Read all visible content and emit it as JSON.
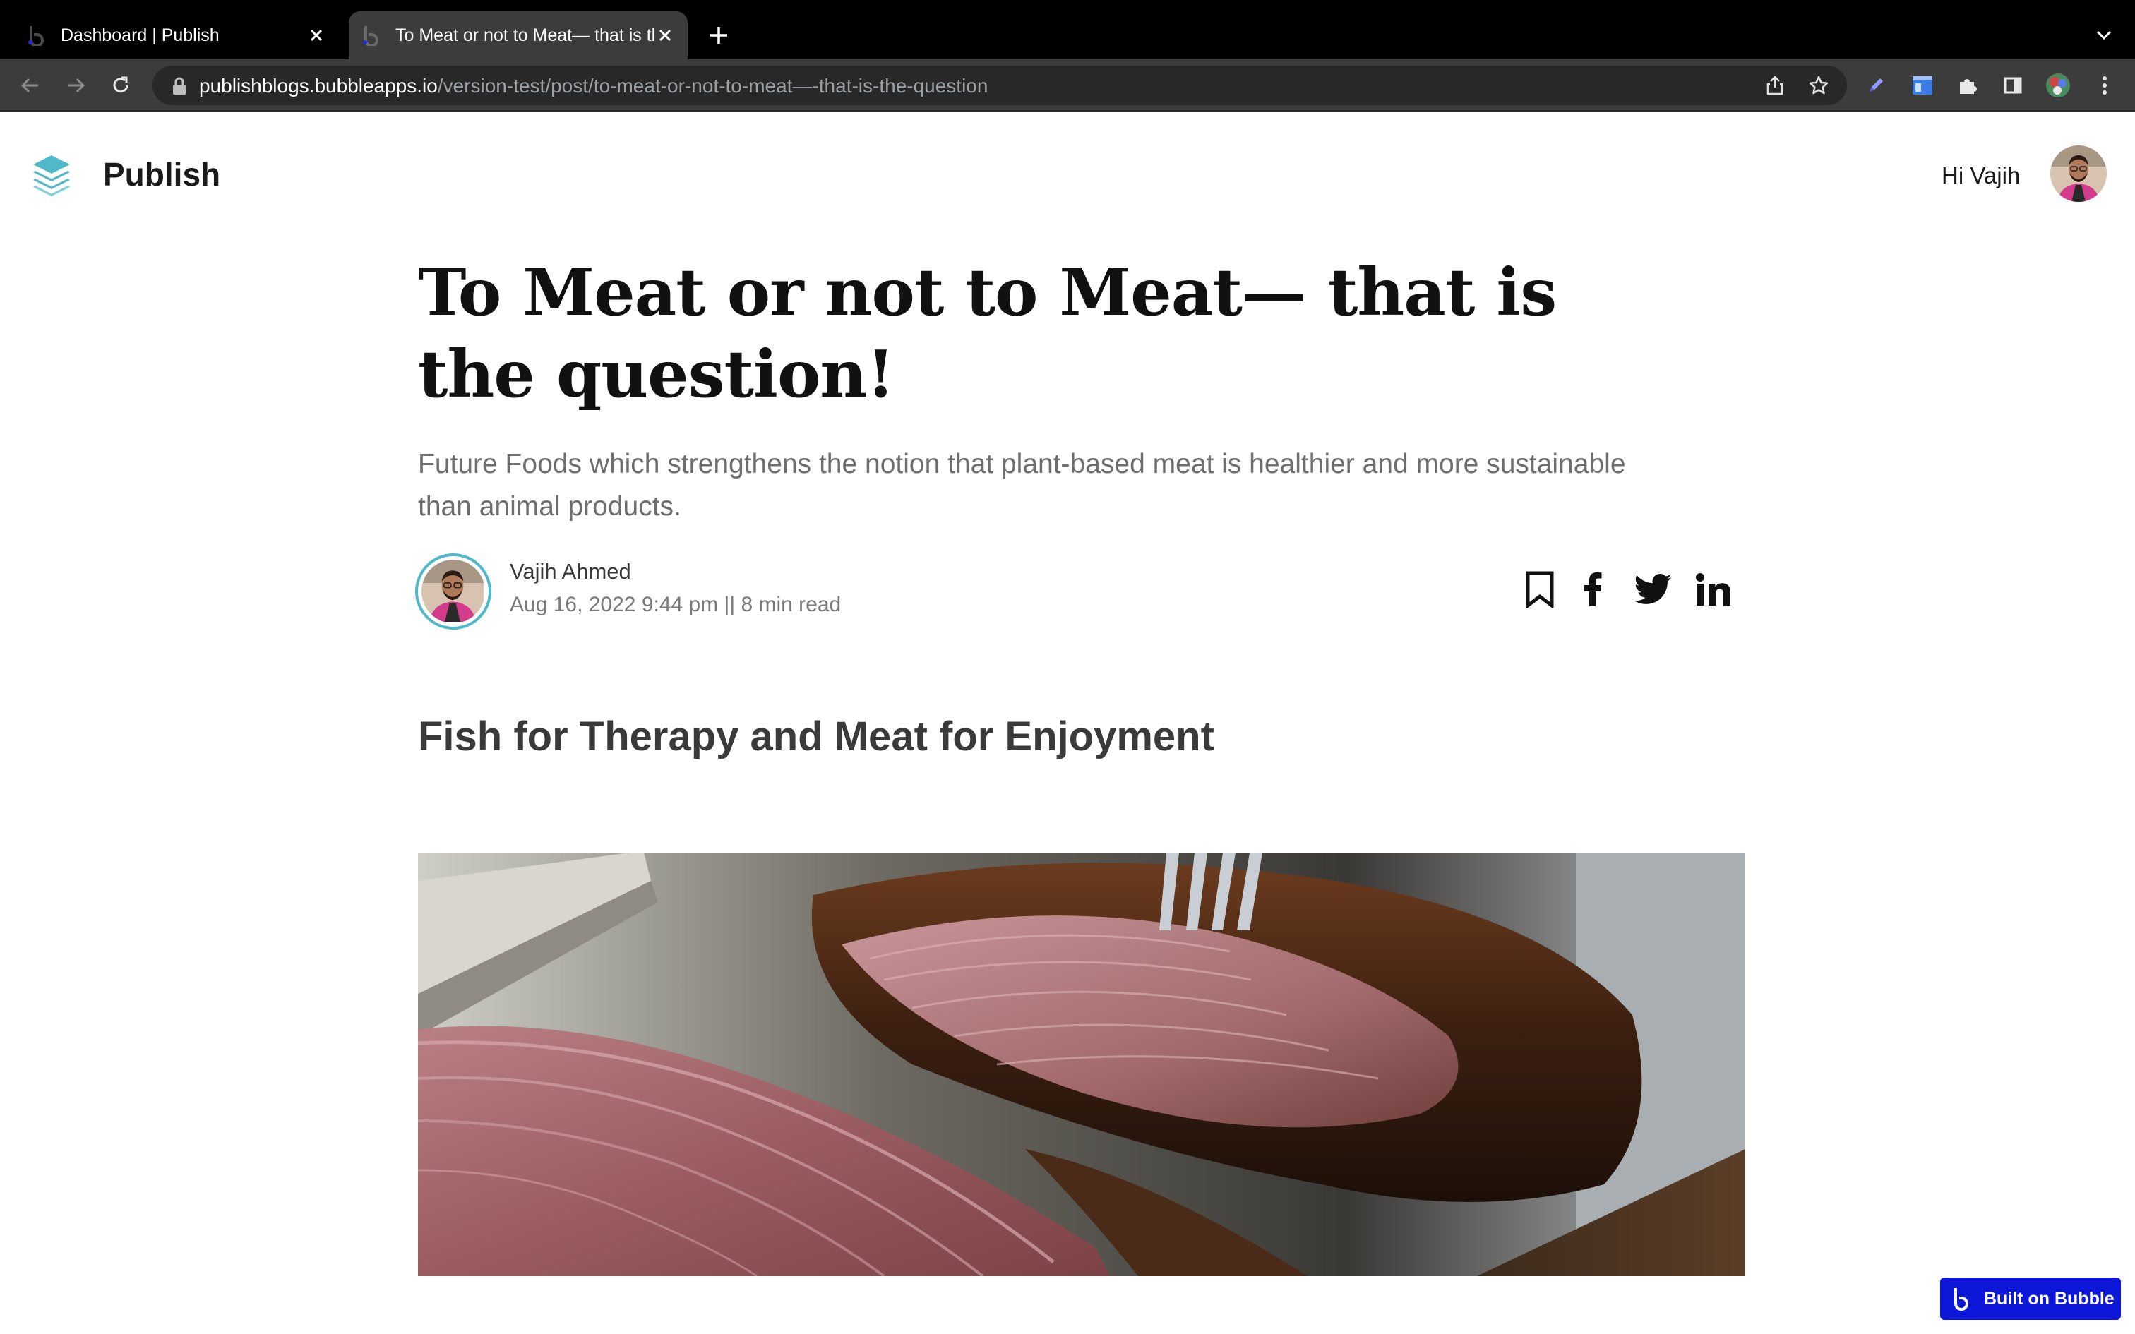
{
  "browser": {
    "tabs": [
      {
        "title": "Dashboard | Publish",
        "active": false
      },
      {
        "title": "To Meat or not to Meat— that is the question!",
        "active": true
      }
    ],
    "url_host": "publishblogs.bubbleapps.io",
    "url_path": "/version-test/post/to-meat-or-not-to-meat—-that-is-the-question",
    "icons": [
      "back-icon",
      "forward-icon",
      "reload-icon",
      "lock-icon",
      "share-icon",
      "star-icon",
      "pen-extension-icon",
      "layout-extension-icon",
      "puzzle-icon",
      "sidepanel-icon",
      "profile-icon",
      "kebab-menu-icon"
    ]
  },
  "header": {
    "site_name": "Publish",
    "greeting": "Hi Vajih",
    "logo_color": "#4fb8c9"
  },
  "article": {
    "title": "To Meat or not to Meat— that is the question!",
    "subtitle": "Future Foods which strengthens the notion that plant-based meat is healthier and more sustainable than animal products.",
    "author": "Vajih Ahmed",
    "meta": "Aug 16, 2022 9:44 pm || 8 min read",
    "section_heading": "Fish for Therapy and Meat for Enjoyment",
    "share_icons": [
      "bookmark-icon",
      "facebook-icon",
      "twitter-icon",
      "linkedin-icon"
    ]
  },
  "badge": {
    "label": "Built on Bubble",
    "color": "#0d17d8"
  }
}
